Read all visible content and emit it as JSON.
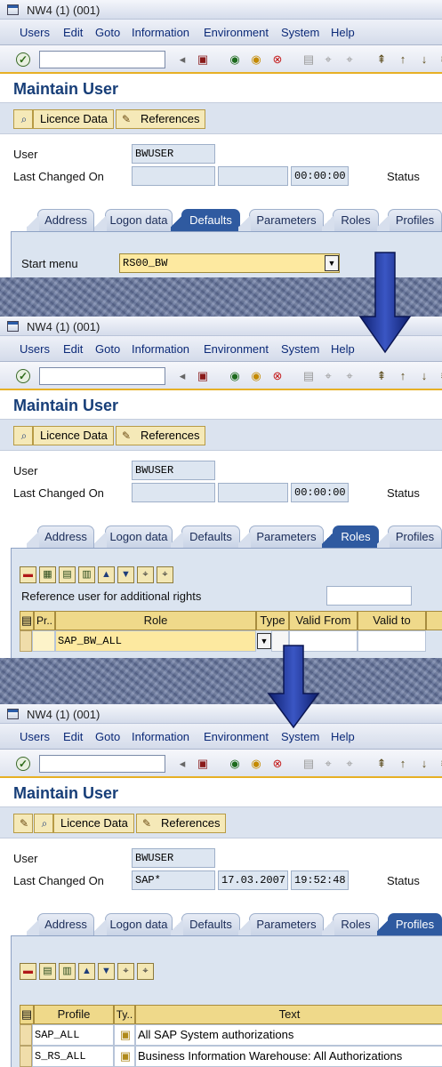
{
  "window": {
    "title": "NW4 (1) (001)",
    "menu": [
      "Users",
      "Edit",
      "Goto",
      "Information",
      "Environment",
      "System",
      "Help"
    ],
    "page_title": "Maintain User",
    "app_buttons": {
      "licence": "Licence Data",
      "references": "References"
    },
    "labels": {
      "user": "User",
      "last_changed": "Last Changed On",
      "status": "Status"
    },
    "tabs": [
      "Address",
      "Logon data",
      "Defaults",
      "Parameters",
      "Roles",
      "Profiles"
    ]
  },
  "panel1": {
    "user": "BWUSER",
    "changed_by": "",
    "date": "",
    "time": "00:00:00",
    "active_tab": "Defaults",
    "start_menu_label": "Start menu",
    "start_menu_value": "RS00_BW"
  },
  "panel2": {
    "user": "BWUSER",
    "changed_by": "",
    "date": "",
    "time": "00:00:00",
    "active_tab": "Roles",
    "reference_label": "Reference user for additional rights",
    "reference_value": "",
    "columns": [
      "Pr..",
      "Role",
      "Type",
      "Valid From",
      "Valid to"
    ],
    "rows": [
      {
        "role": "SAP_BW_ALL",
        "type": "",
        "valid_from": "",
        "valid_to": ""
      }
    ]
  },
  "panel3": {
    "user": "BWUSER",
    "changed_by": "SAP*",
    "date": "17.03.2007",
    "time": "19:52:48",
    "active_tab": "Profiles",
    "columns": [
      "Profile",
      "Ty..",
      "Text"
    ],
    "rows": [
      {
        "profile": "SAP_ALL",
        "text": "All SAP System authorizations"
      },
      {
        "profile": "S_RS_ALL",
        "text": "Business Information Warehouse: All Authorizations"
      }
    ]
  },
  "colors": {
    "accent": "#2f5aa0",
    "title_blue": "#173e78",
    "arrow": "#1b2f8f",
    "toolbar_rule": "#e7b025"
  }
}
